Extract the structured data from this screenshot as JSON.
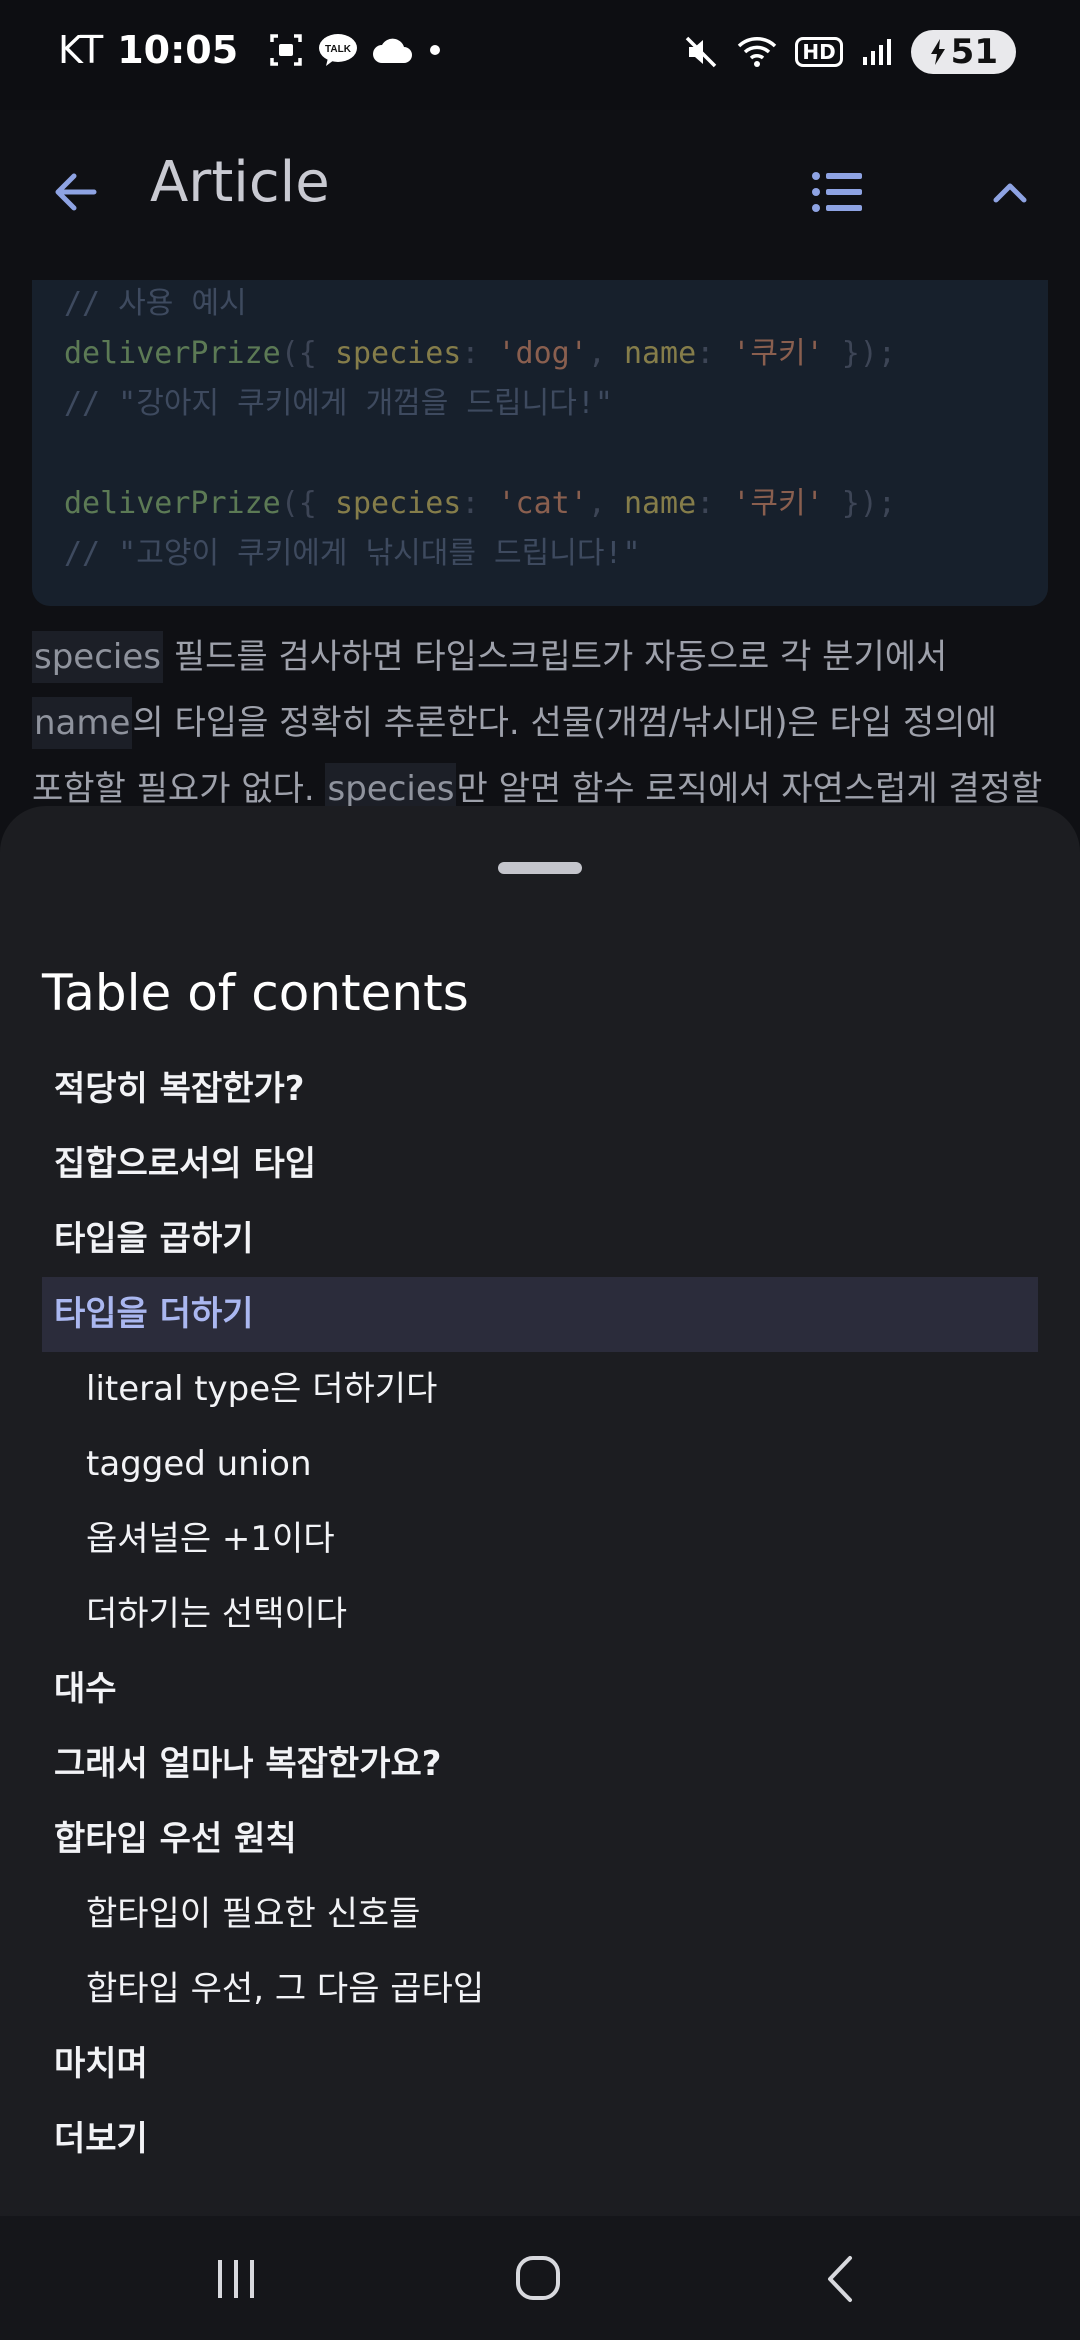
{
  "status_bar": {
    "carrier": "KT",
    "time": "10:05",
    "battery": "51",
    "notification_icons": [
      "screenshot-icon",
      "kakaotalk-icon",
      "cloud-icon",
      "dot-icon"
    ],
    "system_icons": [
      "mute-icon",
      "wifi-icon",
      "hd-icon",
      "signal-icon",
      "battery-icon"
    ],
    "hd_label": "HD",
    "talk_label": "TALK"
  },
  "app_bar": {
    "title": "Article"
  },
  "code_block": {
    "lines": [
      {
        "comment": "// 사용 예시"
      },
      {
        "fn": "deliverPrize",
        "p1": "({ ",
        "k1": "species",
        "c1": ": ",
        "s1": "'dog'",
        "p2": ", ",
        "k2": "name",
        "c2": ": ",
        "s2": "'쿠키'",
        "p3": " });"
      },
      {
        "comment": "// \"강아지 쿠키에게 개껌을 드립니다!\""
      },
      {
        "fn": "deliverPrize",
        "p1": "({ ",
        "k1": "species",
        "c1": ": ",
        "s1": "'cat'",
        "p2": ", ",
        "k2": "name",
        "c2": ": ",
        "s2": "'쿠키'",
        "p3": " });"
      },
      {
        "comment": "// \"고양이 쿠키에게 낚시대를 드립니다!\""
      }
    ]
  },
  "paragraph": {
    "line1_code": "species",
    "line1_text": " 필드를 검사하면 타입스크립트가 자동으로 각 분기에서",
    "line2_code": "name",
    "line2_text": "의 타입을 정확히 추론한다. 선물(개껌/낚시대)은 타입 정의에",
    "line3_text_a": "포함할 필요가 없다. ",
    "line3_code": "species",
    "line3_text_b": "만 알면 함수 로직에서 자연스럽게 결정할"
  },
  "toc": {
    "title": "Table of contents",
    "items": [
      {
        "label": "적당히 복잡한가?",
        "level": 2,
        "active": false
      },
      {
        "label": "집합으로서의 타입",
        "level": 2,
        "active": false
      },
      {
        "label": "타입을 곱하기",
        "level": 2,
        "active": false
      },
      {
        "label": "타입을 더하기",
        "level": 2,
        "active": true
      },
      {
        "label": "literal type은 더하기다",
        "level": 3,
        "active": false
      },
      {
        "label": "tagged union",
        "level": 3,
        "active": false
      },
      {
        "label": "옵셔널은 +1이다",
        "level": 3,
        "active": false
      },
      {
        "label": "더하기는 선택이다",
        "level": 3,
        "active": false
      },
      {
        "label": "대수",
        "level": 2,
        "active": false
      },
      {
        "label": "그래서 얼마나 복잡한가요?",
        "level": 2,
        "active": false
      },
      {
        "label": "합타입 우선 원칙",
        "level": 2,
        "active": false
      },
      {
        "label": "합타입이 필요한 신호들",
        "level": 3,
        "active": false
      },
      {
        "label": "합타입 우선, 그 다음 곱타입",
        "level": 3,
        "active": false
      },
      {
        "label": "마치며",
        "level": 2,
        "active": false
      },
      {
        "label": "더보기",
        "level": 2,
        "active": false
      }
    ]
  },
  "colors": {
    "accent": "#aab7f0",
    "sheet_bg": "#1c1d21",
    "active_item_bg": "#2b2c3b"
  }
}
